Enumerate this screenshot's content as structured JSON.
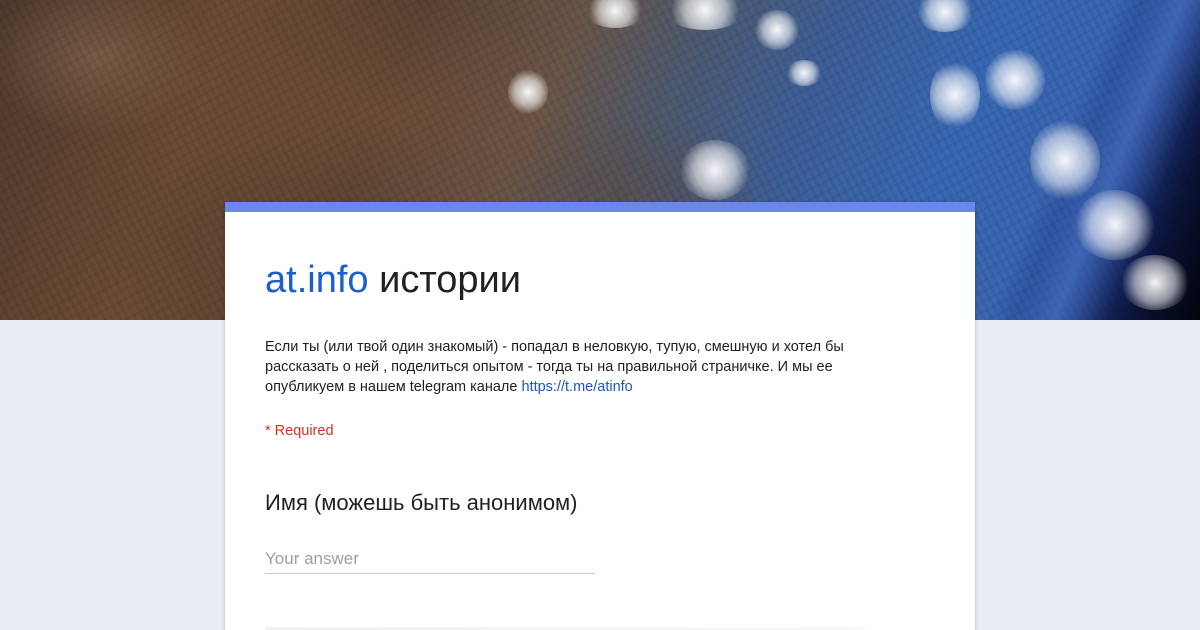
{
  "form": {
    "title_brand": "at.info",
    "title_rest": " истории",
    "description_text": "Если ты (или твой один знакомый) - попадал в неловкую, тупую, смешную  и хотел бы рассказать о ней , поделиться опытом - тогда ты на правильной страничке. И мы ее опубликуем в нашем telegram канале ",
    "description_link": "https://t.me/atinfo",
    "required_note": "* Required",
    "questions": [
      {
        "label": "Имя (можешь быть анонимом)",
        "value": "",
        "placeholder": "Your answer"
      }
    ]
  },
  "colors": {
    "accent": "#6b86ec",
    "brand_text": "#1c5fcc",
    "link": "#1a57c9",
    "required": "#d93025",
    "page_background": "#e9edf6"
  }
}
